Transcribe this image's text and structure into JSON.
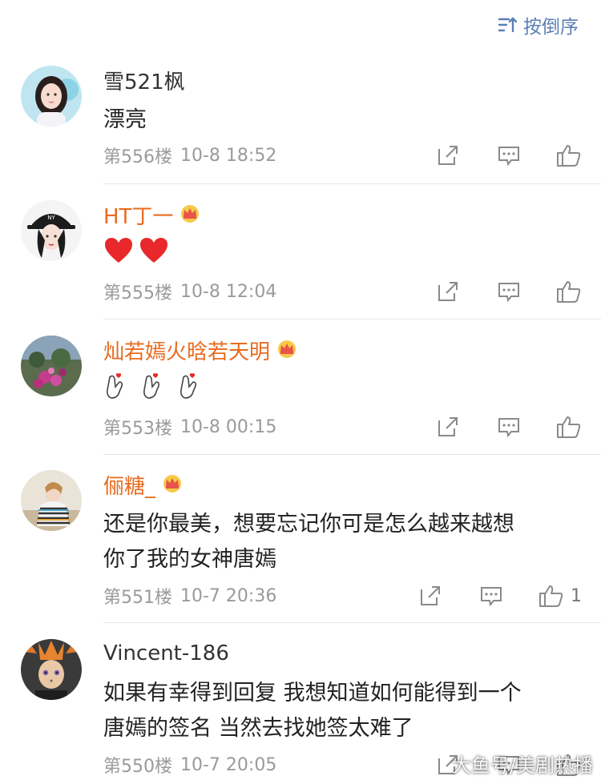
{
  "sort": {
    "label": "按倒序",
    "icon": "sort-icon"
  },
  "comments": [
    {
      "user": "雪521枫",
      "vip": false,
      "content": "漂亮",
      "floor": "第556楼",
      "time": "10-8 18:52",
      "likes": ""
    },
    {
      "user": "HT丁一",
      "vip": true,
      "content_emoji": [
        "heart",
        "heart"
      ],
      "floor": "第555楼",
      "time": "10-8 12:04",
      "likes": ""
    },
    {
      "user": "灿若嫣火晗若天明",
      "vip": true,
      "content_emoji": [
        "finger-heart",
        "finger-heart",
        "finger-heart"
      ],
      "floor": "第553楼",
      "time": "10-8 00:15",
      "likes": ""
    },
    {
      "user": "俪糖_",
      "vip": true,
      "content": "还是你最美，想要忘记你可是怎么越来越想你了我的女神唐嫣",
      "content_lines": [
        "还是你最美，想要忘记你可是怎么越来越想",
        "你了我的女神唐嫣"
      ],
      "floor": "第551楼",
      "time": "10-7 20:36",
      "likes": "1"
    },
    {
      "user": "Vincent-186",
      "vip": false,
      "content_lines": [
        "如果有幸得到回复 我想知道如何能得到一个",
        "唐嫣的签名 当然去找她签太难了"
      ],
      "floor": "第550楼",
      "time": "10-7 20:05",
      "likes": ""
    }
  ],
  "watermark": "大鱼号/美剧热播",
  "colors": {
    "accent": "#5b7fb5",
    "vip_name": "#e86b1f",
    "meta": "#9a9a9a",
    "text": "#222222"
  }
}
